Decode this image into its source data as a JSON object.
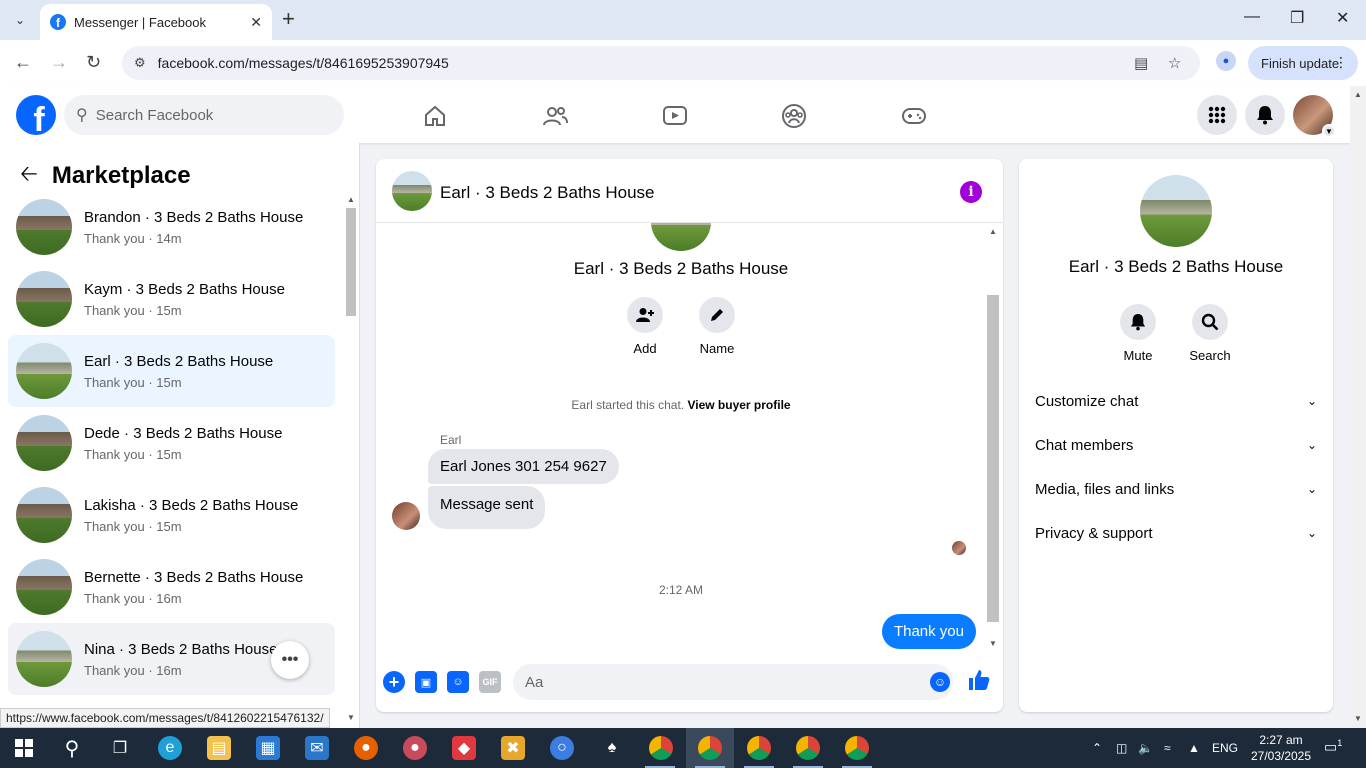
{
  "browser": {
    "tab_title": "Messenger | Facebook",
    "url": "facebook.com/messages/t/8461695253907945",
    "finish_update": "Finish update",
    "status_url": "https://www.facebook.com/messages/t/8412602215476132/"
  },
  "fb": {
    "search_placeholder": "Search Facebook",
    "logo_letter": "f",
    "nav_icons": [
      "home-icon",
      "friends-icon",
      "video-icon",
      "groups-icon",
      "gaming-icon"
    ]
  },
  "left": {
    "title": "Marketplace",
    "conversations": [
      {
        "name": "Brandon · 3 Beds 2 Baths House",
        "snippet": "Thank you · 14m"
      },
      {
        "name": "Kaym · 3 Beds 2 Baths House",
        "snippet": "Thank you · 15m"
      },
      {
        "name": "Earl · 3 Beds 2 Baths House",
        "snippet": "Thank you · 15m"
      },
      {
        "name": "Dede · 3 Beds 2 Baths House",
        "snippet": "Thank you · 15m"
      },
      {
        "name": "Lakisha · 3 Beds 2 Baths House",
        "snippet": "Thank you · 15m"
      },
      {
        "name": "Bernette · 3 Beds 2 Baths House",
        "snippet": "Thank you · 16m"
      },
      {
        "name": "Nina · 3 Beds 2 Baths House",
        "snippet": "Thank you · 16m"
      }
    ]
  },
  "chat": {
    "title": "Earl · 3 Beds 2 Baths House",
    "body_title": "Earl · 3 Beds 2 Baths House",
    "add_label": "Add",
    "name_label": "Name",
    "started_text": "Earl started this chat.",
    "buyer_link": "View buyer profile",
    "sender": "Earl",
    "messages": [
      {
        "from": "Earl",
        "text": "Earl Jones 301 254 9627"
      },
      {
        "from": "Earl",
        "text": "Message sent"
      }
    ],
    "time": "2:12 AM",
    "my_message": "Thank you",
    "input_placeholder": "Aa",
    "gif_label": "GIF"
  },
  "right": {
    "name": "Earl · 3 Beds 2 Baths House",
    "mute_label": "Mute",
    "search_label": "Search",
    "sections": [
      "Customize chat",
      "Chat members",
      "Media, files and links",
      "Privacy & support"
    ]
  },
  "taskbar": {
    "lang": "ENG",
    "time": "2:27 am",
    "date": "27/03/2025",
    "notif_count": "1"
  },
  "colors": {
    "brand": "#0866ff",
    "my_bubble": "#0a7cff",
    "info": "#a200d6",
    "active_row": "#ebf5ff"
  }
}
